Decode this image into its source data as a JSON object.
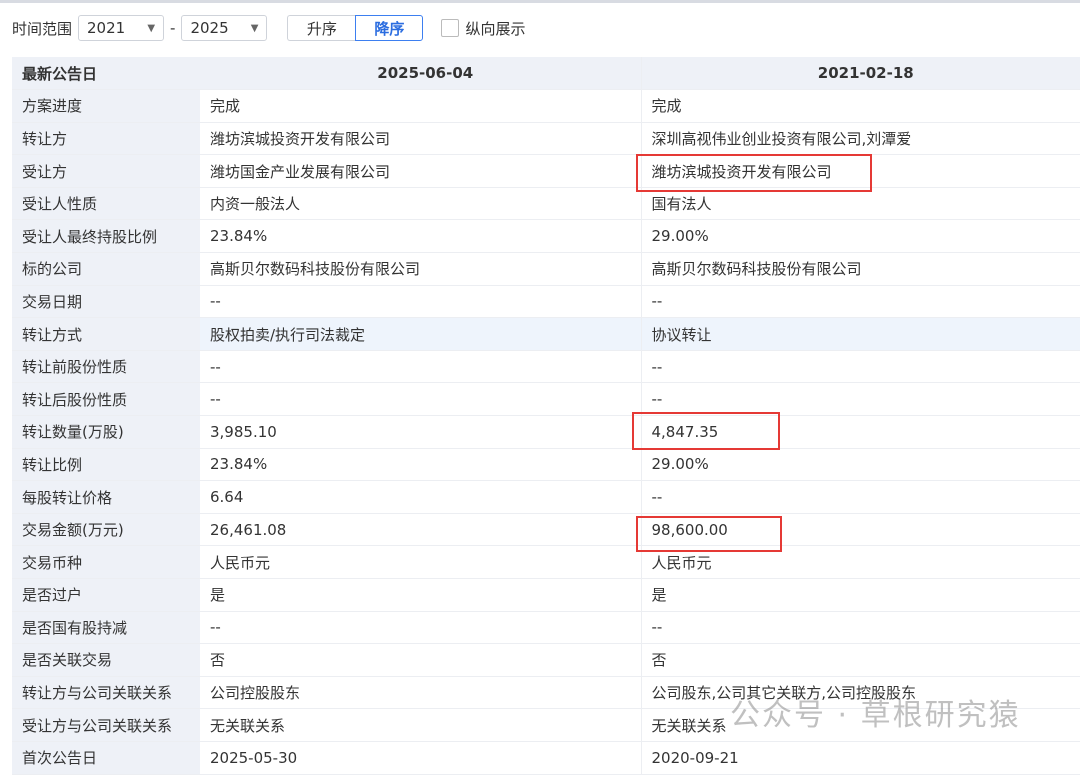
{
  "toolbar": {
    "range_label": "时间范围",
    "from": "2021",
    "to": "2025",
    "sep": "-",
    "asc": "升序",
    "desc": "降序",
    "vertical": "纵向展示"
  },
  "header": {
    "label": "最新公告日",
    "col1": "2025-06-04",
    "col2": "2021-02-18"
  },
  "rows": [
    [
      "方案进度",
      "完成",
      "完成"
    ],
    [
      "转让方",
      "潍坊滨城投资开发有限公司",
      "深圳高视伟业创业投资有限公司,刘潭爱"
    ],
    [
      "受让方",
      "潍坊国金产业发展有限公司",
      "潍坊滨城投资开发有限公司"
    ],
    [
      "受让人性质",
      "内资一般法人",
      "国有法人"
    ],
    [
      "受让人最终持股比例",
      "23.84%",
      "29.00%"
    ],
    [
      "标的公司",
      "高斯贝尔数码科技股份有限公司",
      "高斯贝尔数码科技股份有限公司"
    ],
    [
      "交易日期",
      "--",
      "--"
    ],
    [
      "转让方式",
      "股权拍卖/执行司法裁定",
      "协议转让"
    ],
    [
      "转让前股份性质",
      "--",
      "--"
    ],
    [
      "转让后股份性质",
      "--",
      "--"
    ],
    [
      "转让数量(万股)",
      "3,985.10",
      "4,847.35"
    ],
    [
      "转让比例",
      "23.84%",
      "29.00%"
    ],
    [
      "每股转让价格",
      "6.64",
      "--"
    ],
    [
      "交易金额(万元)",
      "26,461.08",
      "98,600.00"
    ],
    [
      "交易币种",
      "人民币元",
      "人民币元"
    ],
    [
      "是否过户",
      "是",
      "是"
    ],
    [
      "是否国有股持减",
      "--",
      "--"
    ],
    [
      "是否关联交易",
      "否",
      "否"
    ],
    [
      "转让方与公司关联关系",
      "公司控股股东",
      "公司股东,公司其它关联方,公司控股股东"
    ],
    [
      "受让方与公司关联关系",
      "无关联关系",
      "无关联关系"
    ],
    [
      "首次公告日",
      "2025-05-30",
      "2020-09-21"
    ]
  ],
  "watermark": "公众号 · 草根研究猿"
}
